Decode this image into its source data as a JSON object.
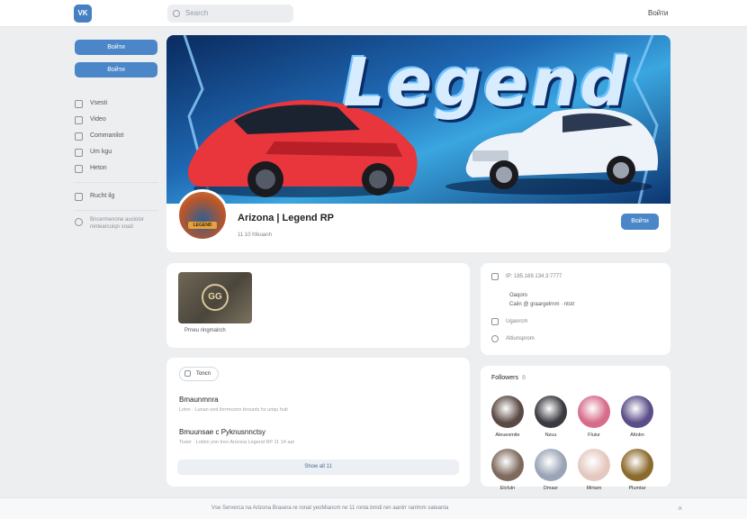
{
  "header": {
    "logo_text": "VK",
    "search_placeholder": "Search",
    "user_label": "Войти"
  },
  "sidebar": {
    "buttons": [
      "Войти",
      "Войти"
    ],
    "menu": [
      "Vsesti",
      "Video",
      "Commanilot",
      "Um kgu",
      "Heton"
    ],
    "extra": "Rucht ilg",
    "note": "Bncermenone auciolor mntearcuiqn snad"
  },
  "group": {
    "cover_title": "Legend",
    "avatar_label": "LEGEND",
    "name": "Arizona | Legend RP",
    "members": "11 10 hfeuanh",
    "follow_label": "Войти"
  },
  "photos": {
    "emblem": "GG",
    "caption": "Prneu ringmalrch"
  },
  "info": {
    "ip_line": "IP: 185.169.134.3:7777",
    "sub1": "Oaqoro",
    "sub2": "Caiin @ graargelrnm · ntstr",
    "row2": "Ugaorcm",
    "row3": "Altiunsprom"
  },
  "posts": {
    "tab_label": "Toncn",
    "items": [
      {
        "title": "Bmaunmnra",
        "sub": "Lotrn · Lunan und ihrrmcorin brounts hs uriqu huit"
      },
      {
        "title": "Bmuunsae c Pyknusnnctsy",
        "sub": "Tiuter · Lotstn ynn tren Arizona Legend RP 11 14 aat"
      }
    ],
    "show_all": "Show all 11"
  },
  "followers": {
    "title": "Followers",
    "count": "8",
    "people": [
      {
        "name": "Aleuesmite",
        "color": "#5a4a44"
      },
      {
        "name": "Nzuu",
        "color": "#3a3a40"
      },
      {
        "name": "Fluiur",
        "color": "#d66b8a"
      },
      {
        "name": "Altnbn",
        "color": "#5b4d88"
      },
      {
        "name": "Elcfuln",
        "color": "#7e6a5d"
      },
      {
        "name": "Dmasr",
        "color": "#9aa4b6"
      },
      {
        "name": "Mirtam",
        "color": "#e4c8c0"
      },
      {
        "name": "Plumtar",
        "color": "#8c6a2c"
      }
    ]
  },
  "cookie": {
    "text": "Vse Serverca na Arizona Brasera re ronat yeoMiancm rw 11 ronta bmdi ren aantrr ranlmm sateanta",
    "close": "×"
  }
}
